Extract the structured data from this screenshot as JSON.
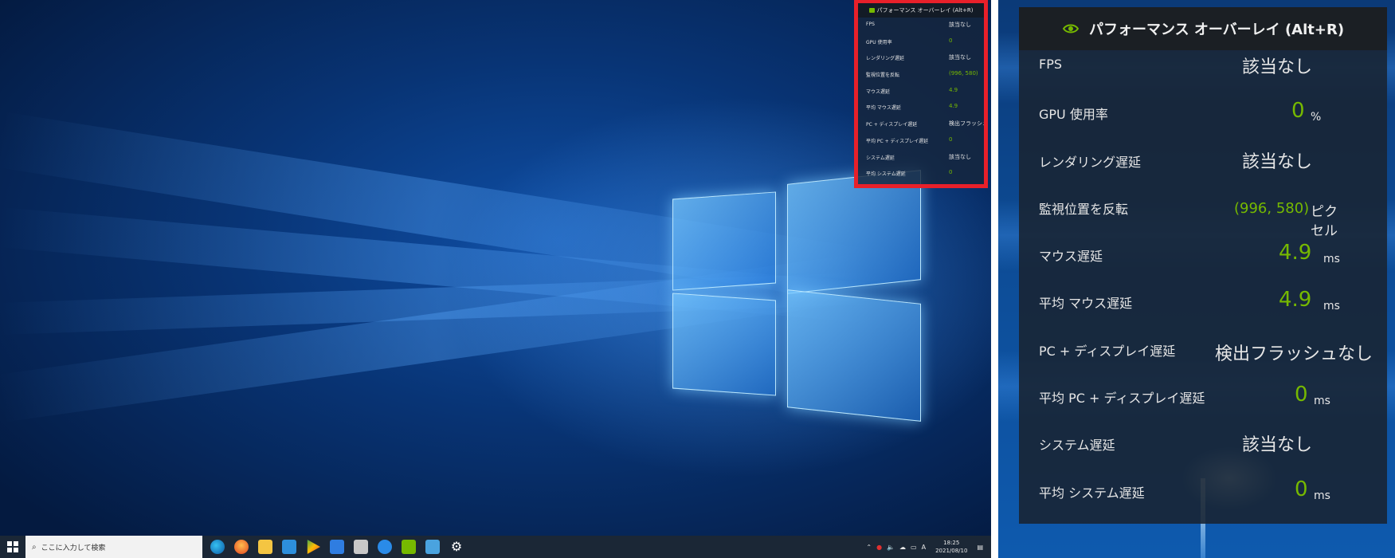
{
  "overlay": {
    "title": "パフォーマンス オーバーレイ (Alt+R)",
    "metrics": [
      {
        "label": "FPS",
        "value": "該当なし",
        "unit": "",
        "highlight": false
      },
      {
        "label": "GPU 使用率",
        "value": "0",
        "unit": "%",
        "highlight": true
      },
      {
        "label": "レンダリング遅延",
        "value": "該当なし",
        "unit": "",
        "highlight": false
      },
      {
        "label": "監視位置を反転",
        "value": "(996, 580)",
        "unit": "ピクセル",
        "highlight": true
      },
      {
        "label": "マウス遅延",
        "value": "4.9",
        "unit": "ms",
        "highlight": true
      },
      {
        "label": "平均 マウス遅延",
        "value": "4.9",
        "unit": "ms",
        "highlight": true
      },
      {
        "label": "PC + ディスプレイ遅延",
        "value": "検出フラッシュなし",
        "unit": "",
        "highlight": false
      },
      {
        "label": "平均 PC + ディスプレイ遅延",
        "value": "0",
        "unit": "ms",
        "highlight": true
      },
      {
        "label": "システム遅延",
        "value": "該当なし",
        "unit": "",
        "highlight": false
      },
      {
        "label": "平均 システム遅延",
        "value": "0",
        "unit": "ms",
        "highlight": true
      }
    ],
    "monitor_unit_line1": "ピク",
    "monitor_unit_line2": "セル"
  },
  "taskbar": {
    "search_placeholder": "ここに入力して検索",
    "clock_time": "18:25",
    "clock_date": "2021/08/10",
    "ime": "A"
  },
  "colors": {
    "accent_green": "#76b900",
    "highlight_border": "#e8202a",
    "nvidia_logo": "#76b900"
  }
}
